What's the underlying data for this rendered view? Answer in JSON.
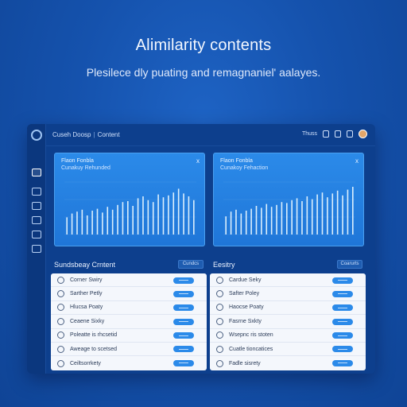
{
  "hero": {
    "title": "Alimilarity contents",
    "subtitle": "Plesilece dly puating and remagnaniel' aalayes."
  },
  "topbar": {
    "app_name": "Cuseh Doosp",
    "section": "Content",
    "right_text": "Thuss"
  },
  "charts": [
    {
      "title": "Flaon Fonbla",
      "subtitle": "Cunakuy Rehunded",
      "close": "x",
      "bar_values": [
        18,
        22,
        24,
        26,
        20,
        25,
        27,
        23,
        29,
        26,
        31,
        34,
        35,
        30,
        38,
        40,
        36,
        34,
        42,
        39,
        41,
        44,
        48,
        43,
        40,
        36
      ]
    },
    {
      "title": "Flaon Fonbla",
      "subtitle": "Cunakoy Fehaction",
      "close": "x",
      "bar_values": [
        19,
        24,
        26,
        22,
        25,
        27,
        30,
        28,
        32,
        29,
        31,
        34,
        33,
        36,
        38,
        35,
        40,
        37,
        42,
        44,
        39,
        43,
        46,
        41,
        47,
        50
      ]
    }
  ],
  "panels": [
    {
      "title": "Sundsbeay Crntent",
      "button": "Cundcs",
      "rows": [
        {
          "icon": "settings-icon",
          "label": "Corner Swiry",
          "toggle_color": "#2b8ae9"
        },
        {
          "icon": "refresh-icon",
          "label": "Sarther Petly",
          "toggle_color": "#2b8ae9"
        },
        {
          "icon": "file-icon",
          "label": "Hlucsa Poaty",
          "toggle_color": "#2b8ae9"
        },
        {
          "icon": "refresh-icon",
          "label": "Ceaene Sixky",
          "toggle_color": "#2b8ae9"
        },
        {
          "icon": "edit-icon",
          "label": "Poleatte is rhcsetid",
          "toggle_color": "#2b8ae9"
        },
        {
          "icon": "edit-icon",
          "label": "Aweage to scetsed",
          "toggle_color": "#2b8ae9"
        },
        {
          "icon": "settings-icon",
          "label": "Ceiltsorrkety",
          "toggle_color": "#2b8ae9"
        }
      ]
    },
    {
      "title": "Eesitry",
      "button": "Coarurts",
      "rows": [
        {
          "icon": "settings-icon",
          "label": "Cardue Seky",
          "toggle_color": "#2b8ae9"
        },
        {
          "icon": "refresh-icon",
          "label": "Safter Poley",
          "toggle_color": "#2b8ae9"
        },
        {
          "icon": "file-icon",
          "label": "Haocse Poaty",
          "toggle_color": "#2b8ae9"
        },
        {
          "icon": "refresh-icon",
          "label": "Fasrne Sxkty",
          "toggle_color": "#2b8ae9"
        },
        {
          "icon": "edit-icon",
          "label": "Wsepnc ris stoten",
          "toggle_color": "#2b8ae9"
        },
        {
          "icon": "edit-icon",
          "label": "Cuatle tioncatices",
          "toggle_color": "#2b8ae9"
        },
        {
          "icon": "settings-icon",
          "label": "Fadle sisrety",
          "toggle_color": "#2b8ae9"
        }
      ]
    }
  ]
}
